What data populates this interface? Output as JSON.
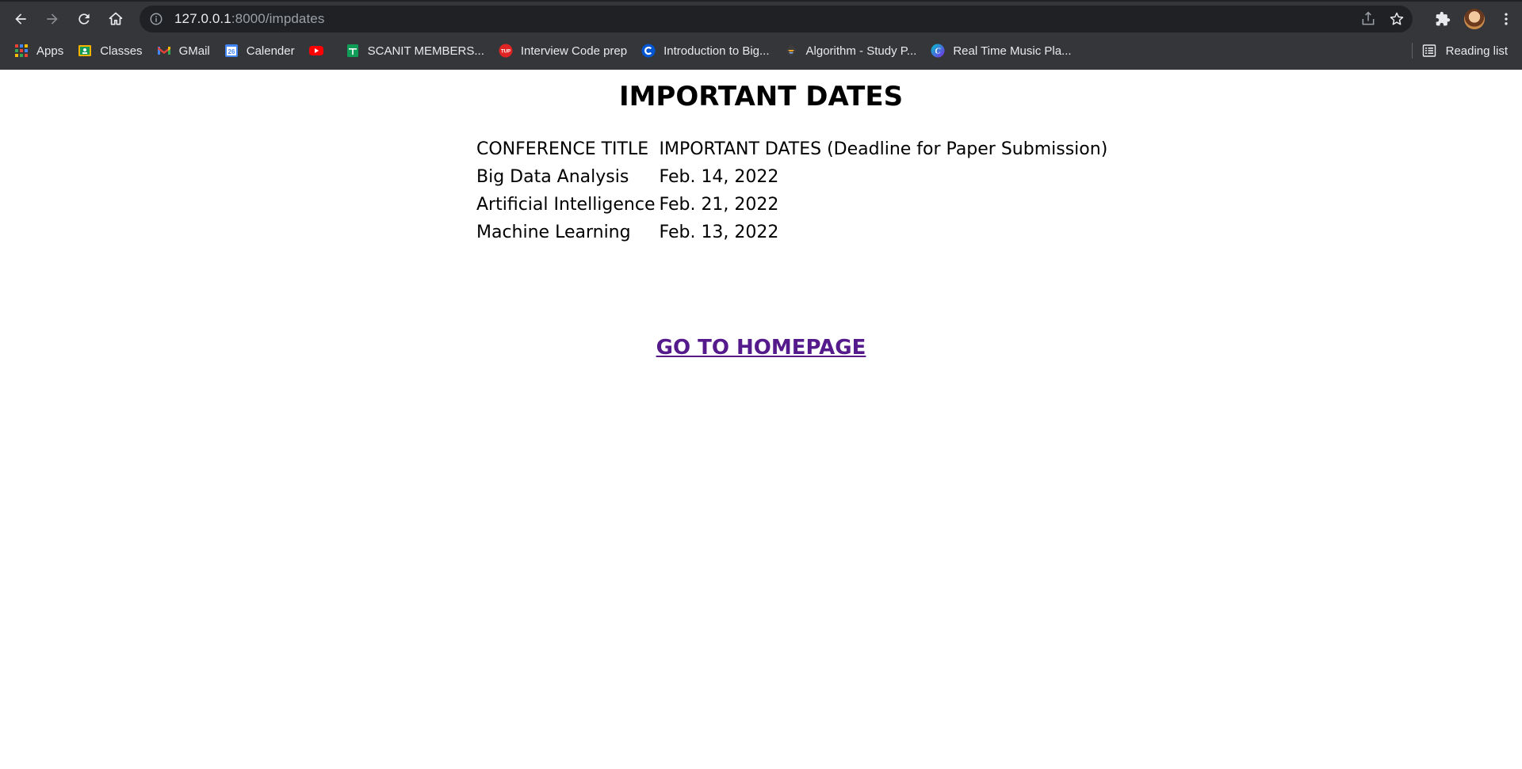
{
  "browser": {
    "url_host": "127.0.0.1",
    "url_rest": ":8000/impdates",
    "bookmarks": [
      {
        "label": "Apps",
        "icon": "apps-grid-icon"
      },
      {
        "label": "Classes",
        "icon": "google-classroom-icon"
      },
      {
        "label": "GMail",
        "icon": "gmail-icon"
      },
      {
        "label": "Calender",
        "icon": "google-calendar-icon"
      },
      {
        "label": "",
        "icon": "youtube-icon"
      },
      {
        "label": "SCANIT MEMBERS...",
        "icon": "google-sheets-icon"
      },
      {
        "label": "Interview Code prep",
        "icon": "tutorialspoint-icon"
      },
      {
        "label": "Introduction to Big...",
        "icon": "coursera-icon"
      },
      {
        "label": "Algorithm - Study P...",
        "icon": "study-planner-icon"
      },
      {
        "label": "Real Time Music Pla...",
        "icon": "canva-icon"
      }
    ],
    "reading_list": "Reading list",
    "colors": {
      "chrome_bg": "#35363a",
      "omnibox_bg": "#202124",
      "visited_link": "#551a8b"
    }
  },
  "page": {
    "title": "IMPORTANT DATES",
    "table": {
      "header": [
        "CONFERENCE TITLE",
        "IMPORTANT DATES (Deadline for Paper Submission)"
      ],
      "rows": [
        [
          "Big Data Analysis",
          "Feb. 14, 2022"
        ],
        [
          "Artificial Intelligence",
          "Feb. 21, 2022"
        ],
        [
          "Machine Learning",
          "Feb. 13, 2022"
        ]
      ]
    },
    "home_link": "GO TO HOMEPAGE"
  }
}
